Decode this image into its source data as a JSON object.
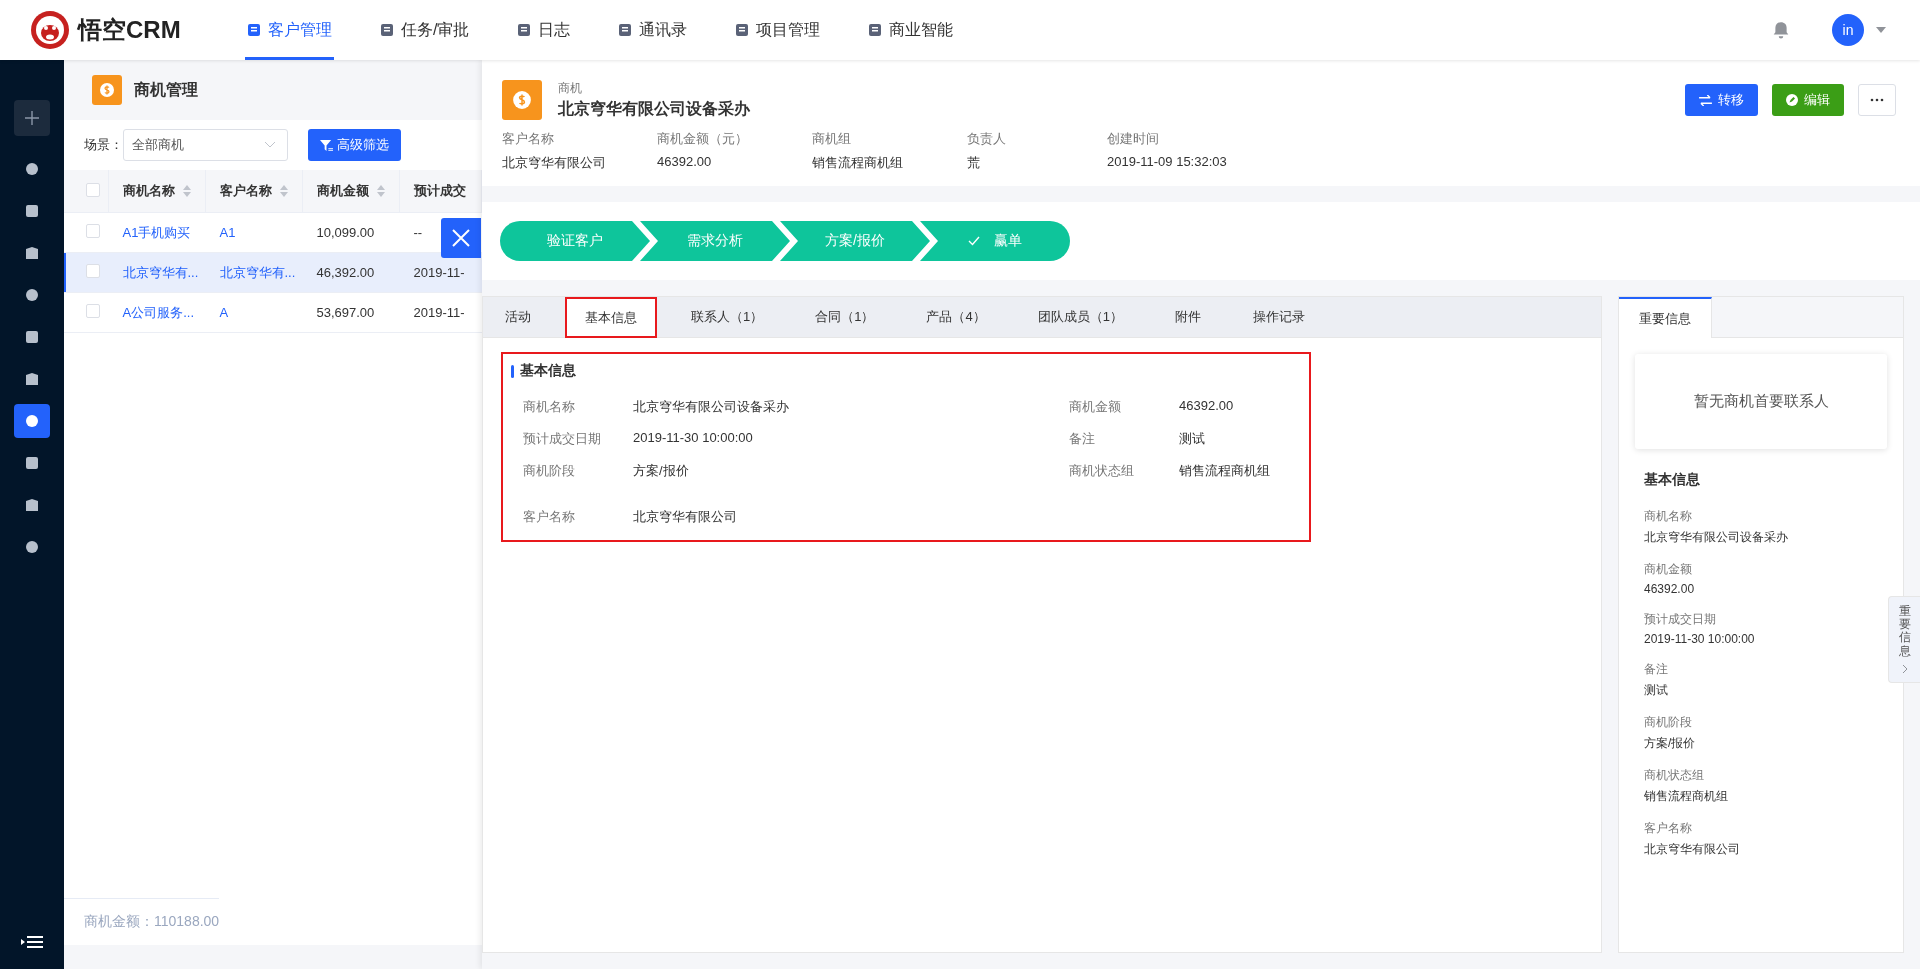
{
  "brand": {
    "name": "悟空CRM"
  },
  "nav": [
    {
      "label": "客户管理",
      "selected": true
    },
    {
      "label": "任务/审批",
      "selected": false
    },
    {
      "label": "日志",
      "selected": false
    },
    {
      "label": "通讯录",
      "selected": false
    },
    {
      "label": "项目管理",
      "selected": false
    },
    {
      "label": "商业智能",
      "selected": false
    }
  ],
  "user": {
    "avatar": "in"
  },
  "sidebar": {
    "items": [
      {
        "selected": false
      },
      {
        "selected": false
      },
      {
        "selected": false
      },
      {
        "selected": false
      },
      {
        "selected": false
      },
      {
        "selected": false
      },
      {
        "selected": true
      },
      {
        "selected": false
      },
      {
        "selected": false
      },
      {
        "selected": false
      }
    ]
  },
  "list": {
    "title": "商机管理",
    "scene_label": "场景：",
    "scene_value": "全部商机",
    "filter_button": "高级筛选",
    "all_checked": false,
    "columns": [
      "商机名称",
      "客户名称",
      "商机金额",
      "预计成交"
    ],
    "rows": [
      {
        "selected": false,
        "checked": false,
        "cells": [
          "A1手机购买",
          "A1",
          "10,099.00",
          "--"
        ]
      },
      {
        "selected": true,
        "checked": false,
        "cells": [
          "北京穹华有...",
          "北京穹华有...",
          "46,392.00",
          "2019-11-"
        ]
      },
      {
        "selected": false,
        "checked": false,
        "cells": [
          "A公司服务...",
          "A",
          "53,697.00",
          "2019-11-"
        ]
      }
    ],
    "total": "商机金额：110188.00"
  },
  "detail": {
    "type_label": "商机",
    "title": "北京穹华有限公司设备采办",
    "buttons": [
      {
        "kind": "transfer",
        "label": "转移"
      },
      {
        "kind": "edit",
        "label": "编辑"
      },
      {
        "kind": "more"
      }
    ],
    "fields": [
      {
        "label": "客户名称",
        "value": "北京穹华有限公司"
      },
      {
        "label": "商机金额（元）",
        "value": "46392.00"
      },
      {
        "label": "商机组",
        "value": "销售流程商机组"
      },
      {
        "label": "负责人",
        "value": "荒"
      },
      {
        "label": "创建时间",
        "value": "2019-11-09 15:32:03"
      }
    ],
    "stages": [
      {
        "label": "验证客户",
        "won": false
      },
      {
        "label": "需求分析",
        "won": false
      },
      {
        "label": "方案/报价",
        "won": false
      },
      {
        "label": "赢单",
        "won": true
      }
    ],
    "tabs": [
      {
        "label": "活动",
        "selected": false,
        "highlighted": false
      },
      {
        "label": "基本信息",
        "selected": true,
        "highlighted": true
      },
      {
        "label": "联系人（1）",
        "selected": false,
        "highlighted": false
      },
      {
        "label": "合同（1）",
        "selected": false,
        "highlighted": false
      },
      {
        "label": "产品（4）",
        "selected": false,
        "highlighted": false
      },
      {
        "label": "团队成员（1）",
        "selected": false,
        "highlighted": false
      },
      {
        "label": "附件",
        "selected": false,
        "highlighted": false
      },
      {
        "label": "操作记录",
        "selected": false,
        "highlighted": false
      }
    ],
    "section": {
      "title": "基本信息",
      "highlighted": true,
      "items": [
        {
          "label": "商机名称",
          "value": "北京穹华有限公司设备采办"
        },
        {
          "label": "商机金额",
          "value": "46392.00"
        },
        {
          "label": "预计成交日期",
          "value": "2019-11-30 10:00:00"
        },
        {
          "label": "备注",
          "value": "测试"
        },
        {
          "label": "商机阶段",
          "value": "方案/报价"
        },
        {
          "label": "商机状态组",
          "value": "销售流程商机组"
        },
        {
          "label": "客户名称",
          "value": "北京穹华有限公司"
        }
      ]
    }
  },
  "side_panel": {
    "tab": "重要信息",
    "empty_contact": "暂无商机首要联系人",
    "section_title": "基本信息",
    "items": [
      {
        "label": "商机名称",
        "value": "北京穹华有限公司设备采办"
      },
      {
        "label": "商机金额",
        "value": "46392.00"
      },
      {
        "label": "预计成交日期",
        "value": "2019-11-30 10:00:00"
      },
      {
        "label": "备注",
        "value": "测试"
      },
      {
        "label": "商机阶段",
        "value": "方案/报价"
      },
      {
        "label": "商机状态组",
        "value": "销售流程商机组"
      },
      {
        "label": "客户名称",
        "value": "北京穹华有限公司"
      }
    ],
    "edge_tab": "重要信息"
  }
}
